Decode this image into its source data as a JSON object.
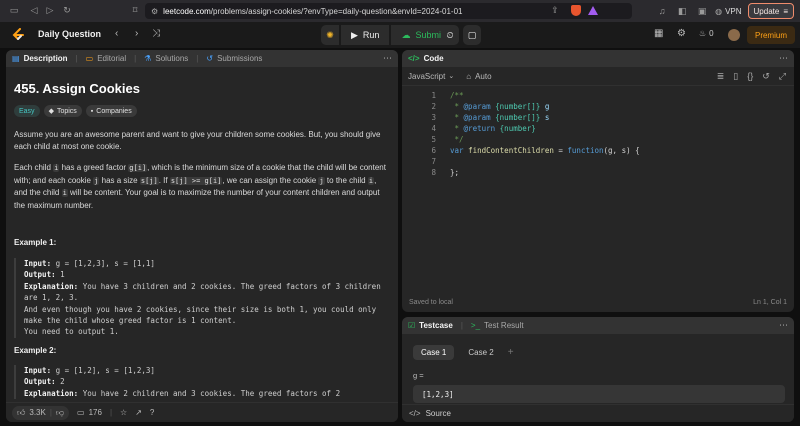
{
  "browser": {
    "url_domain": "leetcode.com",
    "url_path": "/problems/assign-cookies/?envType=daily-question&envId=2024-01-01",
    "vpn_label": "VPN",
    "update_label": "Update"
  },
  "nav": {
    "daily_label": "Daily Question",
    "run_label": "Run",
    "submit_label": "Submit",
    "streak_count": "0",
    "premium_label": "Premium"
  },
  "left_tabs": {
    "description": "Description",
    "editorial": "Editorial",
    "solutions": "Solutions",
    "submissions": "Submissions"
  },
  "problem": {
    "title": "455. Assign Cookies",
    "difficulty": "Easy",
    "topics_label": "Topics",
    "companies_label": "Companies",
    "p1": "Assume you are an awesome parent and want to give your children some cookies. But, you should give each child at most one cookie.",
    "p2_a": "Each child ",
    "p2_i": "i",
    "p2_b": " has a greed factor ",
    "p2_gi": "g[i]",
    "p2_c": ", which is the minimum size of a cookie that the child will be content with; and each cookie ",
    "p2_j": "j",
    "p2_d": " has a size ",
    "p2_sj": "s[j]",
    "p2_e": ". If ",
    "p2_cond": "s[j] >= g[i]",
    "p2_f": ", we can assign the cookie ",
    "p2_j2": "j",
    "p2_g": " to the child ",
    "p2_i2": "i",
    "p2_h": ", and the child ",
    "p2_i3": "i",
    "p2_k": " will be content. Your goal is to maximize the number of your content children and output the maximum number.",
    "example1": {
      "heading": "Example 1:",
      "input_label": "Input:",
      "input": " g = [1,2,3], s = [1,1]",
      "output_label": "Output:",
      "output": " 1",
      "explanation_label": "Explanation:",
      "explanation": " You have 3 children and 2 cookies. The greed factors of 3 children are 1, 2, 3.",
      "line2": "And even though you have 2 cookies, since their size is both 1, you could only make the child whose greed factor is 1 content.",
      "line3": "You need to output 1."
    },
    "example2": {
      "heading": "Example 2:",
      "input_label": "Input:",
      "input": " g = [1,2], s = [1,2,3]",
      "output_label": "Output:",
      "output": " 2",
      "explanation_label": "Explanation:",
      "explanation": " You have 2 children and 3 cookies. The greed factors of 2"
    }
  },
  "left_footer": {
    "likes": "3.3K",
    "comments": "176"
  },
  "code_panel": {
    "title": "Code",
    "language": "JavaScript",
    "mode": "Auto",
    "lines": [
      {
        "n": "1",
        "parts": [
          [
            "cm",
            "/**"
          ]
        ]
      },
      {
        "n": "2",
        "parts": [
          [
            "cm",
            " * "
          ],
          [
            "kw",
            "@param"
          ],
          [
            "cm",
            " "
          ],
          [
            "ty",
            "{number[]}"
          ],
          [
            "cm",
            " "
          ],
          [
            "pr",
            "g"
          ]
        ]
      },
      {
        "n": "3",
        "parts": [
          [
            "cm",
            " * "
          ],
          [
            "kw",
            "@param"
          ],
          [
            "cm",
            " "
          ],
          [
            "ty",
            "{number[]}"
          ],
          [
            "cm",
            " "
          ],
          [
            "pr",
            "s"
          ]
        ]
      },
      {
        "n": "4",
        "parts": [
          [
            "cm",
            " * "
          ],
          [
            "kw",
            "@return"
          ],
          [
            "cm",
            " "
          ],
          [
            "ty",
            "{number}"
          ]
        ]
      },
      {
        "n": "5",
        "parts": [
          [
            "cm",
            " */"
          ]
        ]
      },
      {
        "n": "6",
        "parts": [
          [
            "kw",
            "var"
          ],
          [
            "ct",
            " "
          ],
          [
            "fn",
            "findContentChildren"
          ],
          [
            "ct",
            " = "
          ],
          [
            "kw",
            "function"
          ],
          [
            "ct",
            "(g, s) {"
          ]
        ]
      },
      {
        "n": "7",
        "parts": [
          [
            "ct",
            "    "
          ]
        ]
      },
      {
        "n": "8",
        "parts": [
          [
            "ct",
            "};"
          ]
        ]
      }
    ],
    "saved_label": "Saved to local",
    "cursor_pos": "Ln 1, Col 1"
  },
  "tests": {
    "testcase_tab": "Testcase",
    "result_tab": "Test Result",
    "case1": "Case 1",
    "case2": "Case 2",
    "var_name": "g =",
    "var_value": "[1,2,3]",
    "source_label": "Source"
  }
}
